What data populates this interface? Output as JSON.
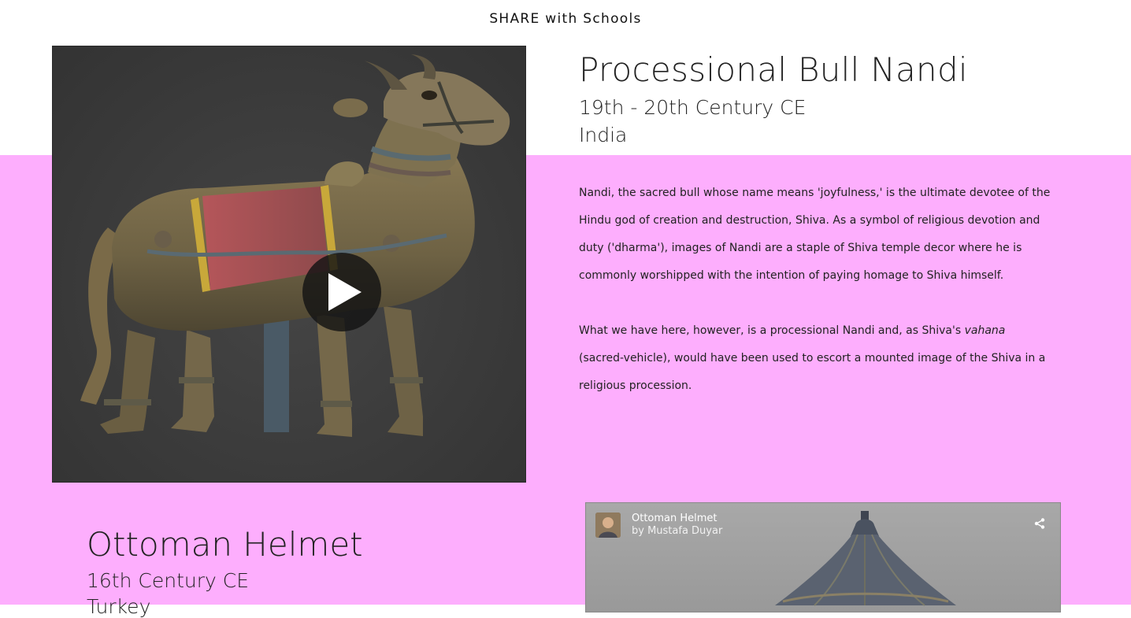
{
  "colors": {
    "band": "#fdaefd",
    "viewer_background": "#3b3b3b",
    "sketchfab_badge": "#1caad9"
  },
  "site": {
    "title": "SHARE with Schools"
  },
  "article_1": {
    "title": "Processional Bull Nandi",
    "date": "19th - 20th Century CE",
    "place": "India",
    "paragraph_1": "Nandi, the sacred bull whose name means 'joyfulness,' is the ultimate devotee of the Hindu god of creation and destruction, Shiva. As a symbol of religious devotion and duty ('dharma'), images of Nandi are a staple of Shiva temple decor where he is commonly worshipped with the intention of paying homage to Shiva himself.",
    "paragraph_2_before": "What we have here, however, is a processional Nandi and, as Shiva's ",
    "paragraph_2_italic": "vahana",
    "paragraph_2_after": " (sacred-vehicle), would have been used to escort a mounted image of the Shiva in a religious procession.",
    "viewer": {
      "play_icon": "play-icon",
      "badge_icon": "sketchfab-logo-icon"
    }
  },
  "article_2": {
    "title": "Ottoman Helmet",
    "date": "16th Century CE",
    "place": "Turkey",
    "viewer": {
      "model_title": "Ottoman Helmet",
      "model_author": "by Mustafa Duyar",
      "share_icon": "share-icon"
    }
  }
}
